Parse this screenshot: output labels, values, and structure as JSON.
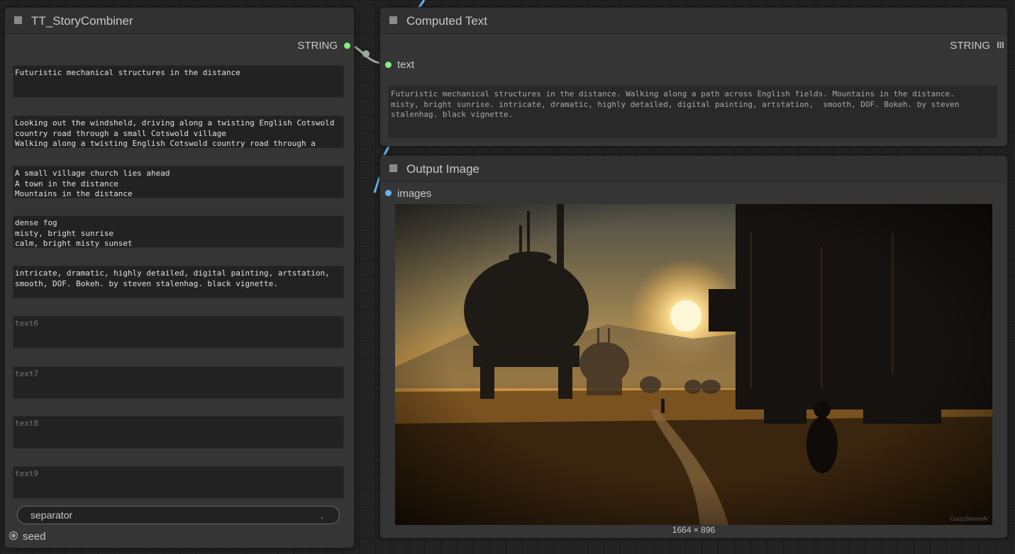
{
  "story_node": {
    "title": "TT_StoryCombiner",
    "output_label": "STRING",
    "texts": [
      {
        "value": "Futuristic mechanical structures in the distance",
        "placeholder": false
      },
      {
        "value": "Looking out the windsheld, driving along a twisting English Cotswold\ncountry road through a small Cotswold village\nWalking along a twisting English Cotswold country road through a",
        "placeholder": false
      },
      {
        "value": "A small village church lies ahead\nA town in the distance\nMountains in the distance",
        "placeholder": false
      },
      {
        "value": "dense fog\nmisty, bright sunrise\ncalm, bright misty sunset",
        "placeholder": false
      },
      {
        "value": "intricate, dramatic, highly detailed, digital painting, artstation,\nsmooth, DOF. Bokeh. by steven stalenhag. black vignette.",
        "placeholder": false
      },
      {
        "value": "text6",
        "placeholder": true
      },
      {
        "value": "text7",
        "placeholder": true
      },
      {
        "value": "text8",
        "placeholder": true
      },
      {
        "value": "text9",
        "placeholder": true
      }
    ],
    "separator_label": "separator",
    "separator_value": ".",
    "seed_label": "seed"
  },
  "computed_node": {
    "title": "Computed Text",
    "output_label": "STRING",
    "input_label": "text",
    "text": "Futuristic mechanical structures in the distance. Walking along a path across English fields. Mountains in the distance.\nmisty, bright sunrise. intricate, dramatic, highly detailed, digital painting, artstation,  smooth, DOF. Bokeh. by steven\nstalenhag. black vignette."
  },
  "output_node": {
    "title": "Output Image",
    "input_label": "images",
    "dimensions": "1664 × 896",
    "watermark": "CrazyStevenAI"
  },
  "colors": {
    "link_string": "#7ef27e",
    "link_image": "#64b5f6",
    "wire": "#8a9a8a"
  }
}
